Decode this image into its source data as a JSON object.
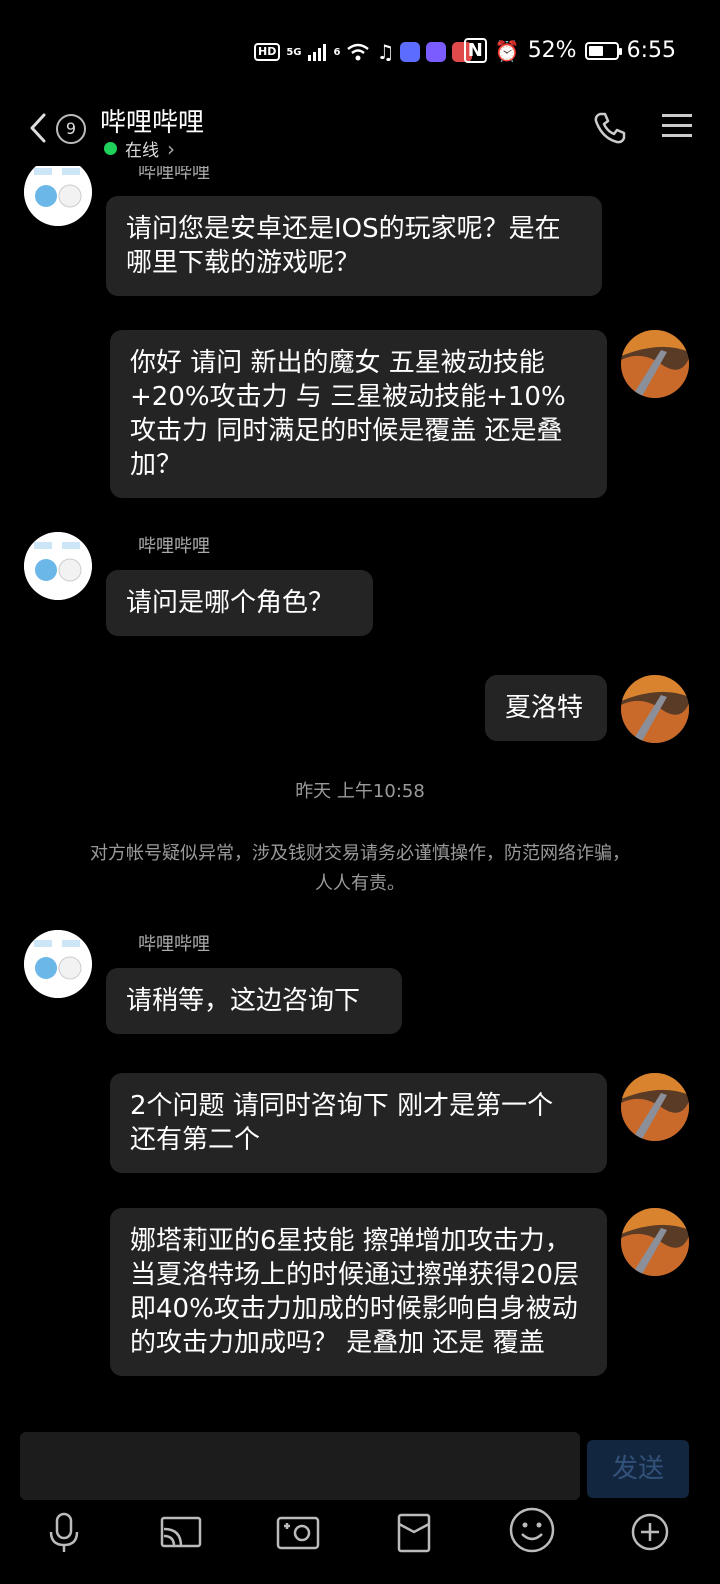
{
  "status_bar": {
    "left_badges": [
      "HD",
      "5G",
      "6"
    ],
    "battery_percent_label": "52%",
    "battery_level": 0.52,
    "time": "6:55",
    "app_icon_colors": [
      "#ffffff",
      "#5b6cff",
      "#7a5cff",
      "#e04a4a"
    ]
  },
  "header": {
    "unread_count": "9",
    "title": "哔哩哔哩",
    "presence": "在线",
    "presence_chevron": "›"
  },
  "chat": {
    "first_sender_partial": "哔哩哔哩",
    "messages": [
      {
        "side": "left",
        "text": "请问您是安卓还是IOS的玩家呢？是在哪里下载的游戏呢？"
      },
      {
        "side": "right",
        "text": "你好 请问 新出的魔女 五星被动技能+20%攻击力 与 三星被动技能+10%攻击力 同时满足的时候是覆盖 还是叠加？"
      },
      {
        "side": "left",
        "sender": "哔哩哔哩",
        "text": "请问是哪个角色？"
      },
      {
        "side": "right",
        "text": "夏洛特"
      },
      {
        "side": "left",
        "sender": "哔哩哔哩",
        "text": "请稍等，这边咨询下"
      },
      {
        "side": "right",
        "text": "2个问题 请同时咨询下 刚才是第一个 还有第二个"
      },
      {
        "side": "right",
        "text": "娜塔莉亚的6星技能 擦弹增加攻击力，当夏洛特场上的时候通过擦弹获得20层 即40%攻击力加成的时候影响自身被动的攻击力加成吗？ 是叠加 还是 覆盖"
      }
    ],
    "timestamp": "昨天 上午10:58",
    "warning_line1": "对方帐号疑似异常，涉及钱财交易请务必谨慎操作，防范网络诈骗，",
    "warning_line2": "人人有责。"
  },
  "composer": {
    "send_label": "发送",
    "toolbar_icons": [
      "microphone-icon",
      "screen-cast-icon",
      "camera-icon",
      "red-packet-icon",
      "emoji-icon",
      "plus-icon"
    ]
  },
  "colors": {
    "background": "#000000",
    "bubble": "#242424",
    "online_green": "#1fd15a",
    "send_button_bg": "#13263f"
  }
}
